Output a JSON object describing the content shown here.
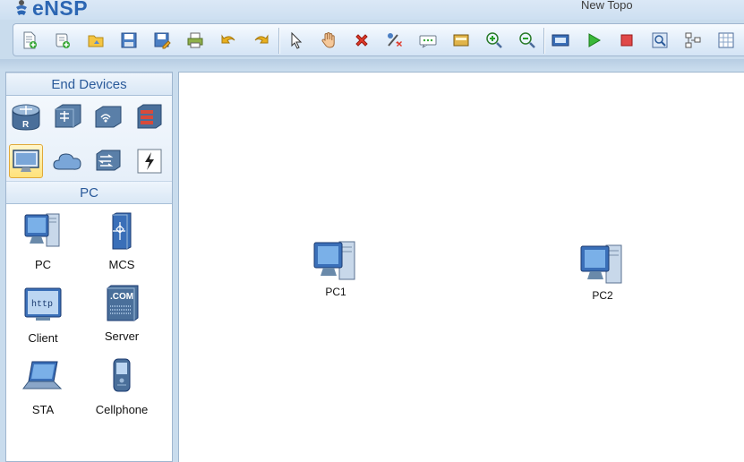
{
  "app": {
    "name": "eNSP",
    "window_title": "New Topo"
  },
  "toolbar": {
    "buttons": [
      {
        "name": "new-topology",
        "icon": "new-file-icon"
      },
      {
        "name": "new-example",
        "icon": "new-example-icon"
      },
      {
        "name": "open",
        "icon": "open-folder-icon"
      },
      {
        "name": "save",
        "icon": "save-icon"
      },
      {
        "name": "save-as",
        "icon": "save-as-icon"
      },
      {
        "name": "print",
        "icon": "print-icon"
      },
      {
        "name": "undo",
        "icon": "undo-icon"
      },
      {
        "name": "redo",
        "icon": "redo-icon"
      },
      {
        "name": "select",
        "icon": "pointer-icon"
      },
      {
        "name": "pan",
        "icon": "hand-icon"
      },
      {
        "name": "delete",
        "icon": "delete-icon"
      },
      {
        "name": "delete-link",
        "icon": "delete-link-icon"
      },
      {
        "name": "text-note",
        "icon": "text-note-icon"
      },
      {
        "name": "palette",
        "icon": "palette-icon"
      },
      {
        "name": "zoom-in",
        "icon": "zoom-in-icon"
      },
      {
        "name": "zoom-out",
        "icon": "zoom-out-icon"
      },
      {
        "name": "fit",
        "icon": "fit-view-icon"
      },
      {
        "name": "start",
        "icon": "play-icon"
      },
      {
        "name": "stop",
        "icon": "stop-icon"
      },
      {
        "name": "capture",
        "icon": "capture-icon"
      },
      {
        "name": "topology",
        "icon": "topology-icon"
      },
      {
        "name": "grid",
        "icon": "grid-icon"
      }
    ]
  },
  "left_panel": {
    "category_header": "End Devices",
    "categories": [
      {
        "name": "router",
        "icon": "router-icon"
      },
      {
        "name": "switch",
        "icon": "switch-icon"
      },
      {
        "name": "wlan",
        "icon": "wireless-icon"
      },
      {
        "name": "firewall",
        "icon": "firewall-icon"
      },
      {
        "name": "end-devices",
        "icon": "pc-monitor-icon",
        "selected": true
      },
      {
        "name": "cloud",
        "icon": "cloud-icon"
      },
      {
        "name": "other-devices",
        "icon": "hub-icon"
      },
      {
        "name": "connections",
        "icon": "lightning-icon"
      }
    ],
    "device_header": "PC",
    "devices": [
      {
        "label": "PC",
        "icon": "pc-icon"
      },
      {
        "label": "MCS",
        "icon": "mcs-server-icon"
      },
      {
        "label": "Client",
        "icon": "http-client-icon"
      },
      {
        "label": "Server",
        "icon": "com-server-icon"
      },
      {
        "label": "STA",
        "icon": "laptop-icon"
      },
      {
        "label": "Cellphone",
        "icon": "cellphone-icon"
      }
    ]
  },
  "canvas": {
    "nodes": [
      {
        "label": "PC1",
        "icon": "pc-icon"
      },
      {
        "label": "PC2",
        "icon": "pc-icon"
      }
    ]
  },
  "colors": {
    "brand": "#2c66b3",
    "header_text": "#2a5a9a",
    "selected_bg": "#ffe27a"
  }
}
